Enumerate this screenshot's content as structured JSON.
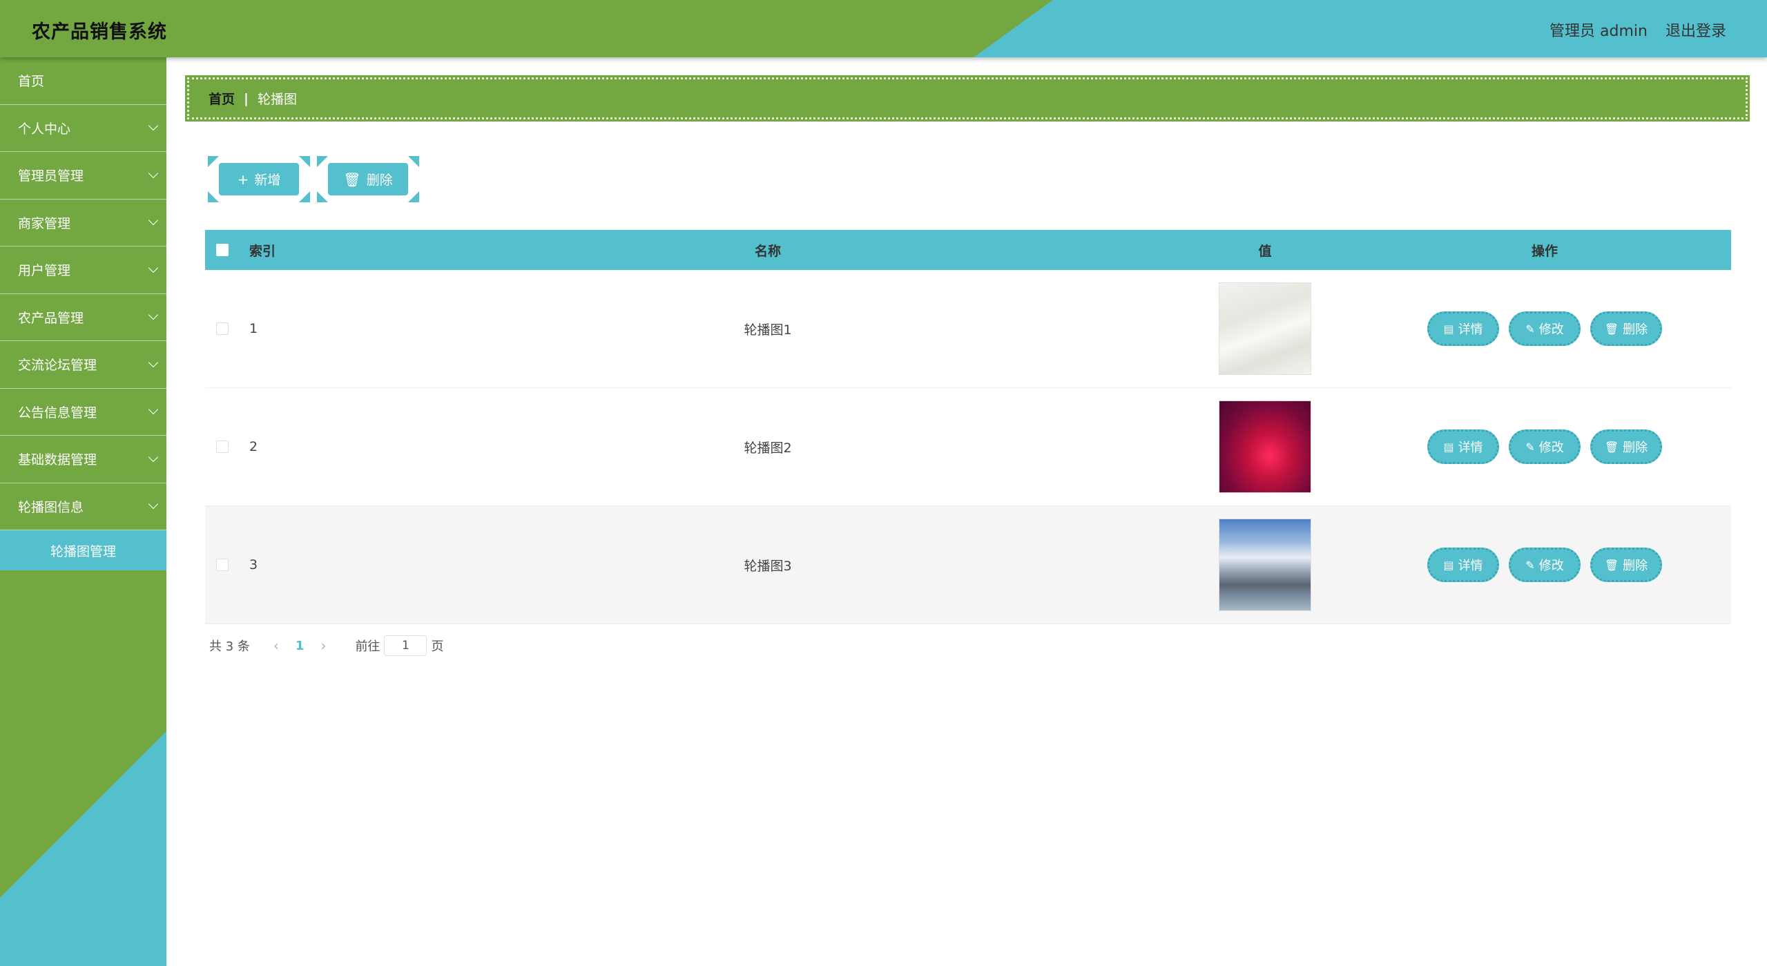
{
  "app": {
    "title": "农产品销售系统",
    "user_label": "管理员 admin",
    "logout_label": "退出登录"
  },
  "colors": {
    "green": "#73a741",
    "teal": "#55c0cd"
  },
  "sidebar": {
    "items": [
      {
        "label": "首页"
      },
      {
        "label": "个人中心"
      },
      {
        "label": "管理员管理"
      },
      {
        "label": "商家管理"
      },
      {
        "label": "用户管理"
      },
      {
        "label": "农产品管理"
      },
      {
        "label": "交流论坛管理"
      },
      {
        "label": "公告信息管理"
      },
      {
        "label": "基础数据管理"
      },
      {
        "label": "轮播图信息"
      }
    ],
    "sub_item": "轮播图管理"
  },
  "breadcrumb": {
    "home": "首页",
    "separator": "|",
    "current": "轮播图"
  },
  "toolbar": {
    "add_label": "新增",
    "delete_label": "删除"
  },
  "table": {
    "headers": {
      "index": "索引",
      "name": "名称",
      "value": "值",
      "ops": "操作"
    },
    "rows": [
      {
        "index": "1",
        "name": "轮播图1"
      },
      {
        "index": "2",
        "name": "轮播图2"
      },
      {
        "index": "3",
        "name": "轮播图3"
      }
    ],
    "ops": {
      "detail": "详情",
      "edit": "修改",
      "delete": "删除"
    }
  },
  "pagination": {
    "total": "共 3 条",
    "current_page": "1",
    "goto": "前往",
    "page_input": "1",
    "page_suffix": "页"
  }
}
